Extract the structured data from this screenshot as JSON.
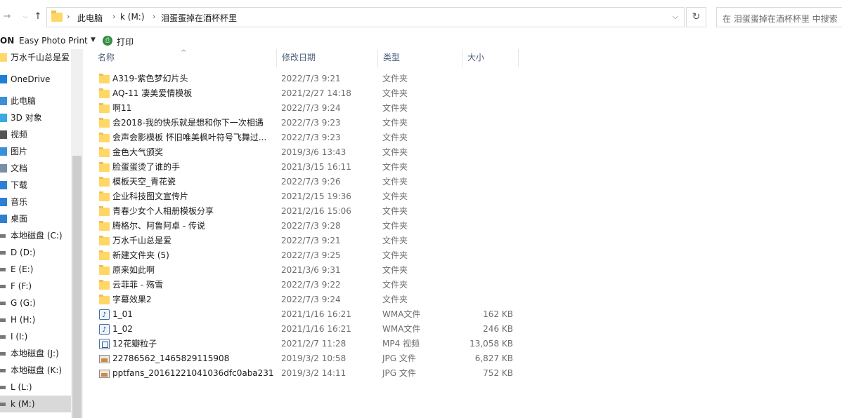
{
  "address": {
    "crumbs": [
      "此电脑",
      "k (M:)",
      "泪蛋蛋掉在酒杯杯里"
    ],
    "search_placeholder": "在 泪蛋蛋掉在酒杯杯里 中搜索"
  },
  "toolbar": {
    "brand": "ON",
    "app": "Easy Photo Print",
    "print": "打印"
  },
  "sidebar": {
    "items": [
      {
        "label": "万水千山总是爱",
        "icon": "folder-icon"
      },
      {
        "label": "OneDrive",
        "icon": "cloud-icon"
      },
      {
        "label": "此电脑",
        "icon": "computer-icon"
      },
      {
        "label": "3D 对象",
        "icon": "cube-icon"
      },
      {
        "label": "视频",
        "icon": "video-icon"
      },
      {
        "label": "图片",
        "icon": "picture-icon"
      },
      {
        "label": "文档",
        "icon": "document-icon"
      },
      {
        "label": "下载",
        "icon": "download-icon"
      },
      {
        "label": "音乐",
        "icon": "music-icon"
      },
      {
        "label": "桌面",
        "icon": "desktop-icon"
      },
      {
        "label": "本地磁盘 (C:)",
        "icon": "drive-icon"
      },
      {
        "label": "D (D:)",
        "icon": "drive-icon"
      },
      {
        "label": "E (E:)",
        "icon": "drive-icon"
      },
      {
        "label": "F (F:)",
        "icon": "drive-icon"
      },
      {
        "label": "G (G:)",
        "icon": "drive-icon"
      },
      {
        "label": "H (H:)",
        "icon": "drive-icon"
      },
      {
        "label": "I (I:)",
        "icon": "drive-icon"
      },
      {
        "label": "本地磁盘 (J:)",
        "icon": "drive-icon"
      },
      {
        "label": "本地磁盘 (K:)",
        "icon": "drive-icon"
      },
      {
        "label": "L (L:)",
        "icon": "drive-icon"
      },
      {
        "label": "k (M:)",
        "icon": "drive-icon"
      }
    ]
  },
  "columns": {
    "name": "名称",
    "date": "修改日期",
    "type": "类型",
    "size": "大小"
  },
  "files": [
    {
      "name": "A319-紫色梦幻片头",
      "date": "2022/7/3 9:21",
      "type": "文件夹",
      "size": "",
      "kind": "folder"
    },
    {
      "name": "AQ-11 凄美爱情模板",
      "date": "2021/2/27 14:18",
      "type": "文件夹",
      "size": "",
      "kind": "folder"
    },
    {
      "name": "啊11",
      "date": "2022/7/3 9:24",
      "type": "文件夹",
      "size": "",
      "kind": "folder"
    },
    {
      "name": "会2018-我的快乐就是想和你下一次相遇",
      "date": "2022/7/3 9:23",
      "type": "文件夹",
      "size": "",
      "kind": "folder"
    },
    {
      "name": "会声会影模板 怀旧唯美枫叶符号飞舞过...",
      "date": "2022/7/3 9:23",
      "type": "文件夹",
      "size": "",
      "kind": "folder"
    },
    {
      "name": "金色大气颁奖",
      "date": "2019/3/6 13:43",
      "type": "文件夹",
      "size": "",
      "kind": "folder"
    },
    {
      "name": "脸蛋蛋烫了谁的手",
      "date": "2021/3/15 16:11",
      "type": "文件夹",
      "size": "",
      "kind": "folder"
    },
    {
      "name": "模板天空_青花瓷",
      "date": "2022/7/3 9:26",
      "type": "文件夹",
      "size": "",
      "kind": "folder"
    },
    {
      "name": "企业科技图文宣传片",
      "date": "2021/2/15 19:36",
      "type": "文件夹",
      "size": "",
      "kind": "folder"
    },
    {
      "name": "青春少女个人相册模板分享",
      "date": "2021/2/16 15:06",
      "type": "文件夹",
      "size": "",
      "kind": "folder"
    },
    {
      "name": "腾格尔、阿鲁阿卓 - 传说",
      "date": "2022/7/3 9:28",
      "type": "文件夹",
      "size": "",
      "kind": "folder"
    },
    {
      "name": "万水千山总是爱",
      "date": "2022/7/3 9:21",
      "type": "文件夹",
      "size": "",
      "kind": "folder"
    },
    {
      "name": "新建文件夹 (5)",
      "date": "2022/7/3 9:25",
      "type": "文件夹",
      "size": "",
      "kind": "folder"
    },
    {
      "name": "原来如此啊",
      "date": "2021/3/6 9:31",
      "type": "文件夹",
      "size": "",
      "kind": "folder"
    },
    {
      "name": "云菲菲 - 殇雪",
      "date": "2022/7/3 9:22",
      "type": "文件夹",
      "size": "",
      "kind": "folder"
    },
    {
      "name": "字幕效果2",
      "date": "2022/7/3 9:24",
      "type": "文件夹",
      "size": "",
      "kind": "folder"
    },
    {
      "name": "1_01",
      "date": "2021/1/16 16:21",
      "type": "WMA文件",
      "size": "162 KB",
      "kind": "wma"
    },
    {
      "name": "1_02",
      "date": "2021/1/16 16:21",
      "type": "WMA文件",
      "size": "246 KB",
      "kind": "wma"
    },
    {
      "name": "12花瓣粒子",
      "date": "2021/2/7 11:28",
      "type": "MP4 视频",
      "size": "13,058 KB",
      "kind": "mp4"
    },
    {
      "name": "22786562_1465829115908",
      "date": "2019/3/2 10:58",
      "type": "JPG 文件",
      "size": "6,827 KB",
      "kind": "jpg"
    },
    {
      "name": "pptfans_20161221041036dfc0aba231",
      "date": "2019/3/2 14:11",
      "type": "JPG 文件",
      "size": "752 KB",
      "kind": "jpg"
    }
  ]
}
